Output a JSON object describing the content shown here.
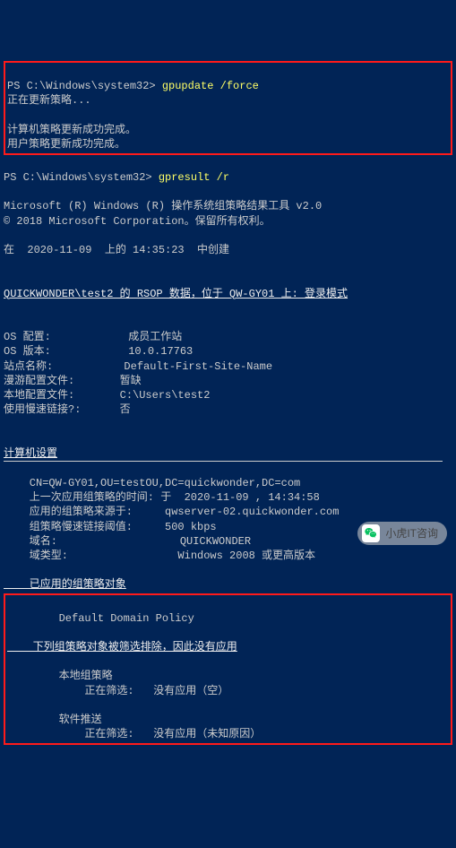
{
  "ps_prompt": "PS C:\\Windows\\system32> ",
  "cmd1": "gpupdate /force",
  "upd_progress": "正在更新策略...",
  "upd_done1": "计算机策略更新成功完成。",
  "upd_done2": "用户策略更新成功完成。",
  "cmd2": "gpresult /r",
  "tool_line1": "Microsoft (R) Windows (R) 操作系统组策略结果工具 v2.0",
  "tool_line2": "© 2018 Microsoft Corporation。保留所有权利。",
  "created_line": "在  2020-11-09  上的 14:35:23  中创建",
  "rsop_line": "QUICKWONDER\\test2 的 RSOP 数据，位于 QW-GY01 上: 登录模式",
  "os_config_label": "OS 配置:            ",
  "os_config_value": "成员工作站",
  "os_ver_label": "OS 版本:            ",
  "os_ver_value": "10.0.17763",
  "site_label": "站点名称:           ",
  "site_value": "Default-First-Site-Name",
  "roam_label": "漫游配置文件:       ",
  "roam_value": "暂缺",
  "local_label": "本地配置文件:       ",
  "local_value": "C:\\Users\\test2",
  "slow_label": "使用慢速链接?:      ",
  "slow_value": "否",
  "computer_header": "计算机设置",
  "cn_line": "    CN=QW-GY01,OU=testOU,DC=quickwonder,DC=com",
  "last_time": "    上一次应用组策略的时间: 于  2020-11-09 , 14:34:58",
  "gp_from": "    应用的组策略来源于:     qwserver-02.quickwonder.com",
  "slow_thresh": "    组策略慢速链接阈值:     500 kbps",
  "domain": "    域名:                   QUICKWONDER",
  "domain_type": "    域类型:                 Windows 2008 或更高版本",
  "applied_header": "    已应用的组策略对象",
  "default_policy": "        Default Domain Policy",
  "filtered_header": "    下列组策略对象被筛选排除，因此没有应用",
  "local_gp": "        本地组策略",
  "local_gp_filter": "            正在筛选:   没有应用（空）",
  "sw_push": "        软件推送",
  "sw_push_filter": "            正在筛选:   没有应用（未知原因）",
  "watermark_text": "小虎IT咨询"
}
